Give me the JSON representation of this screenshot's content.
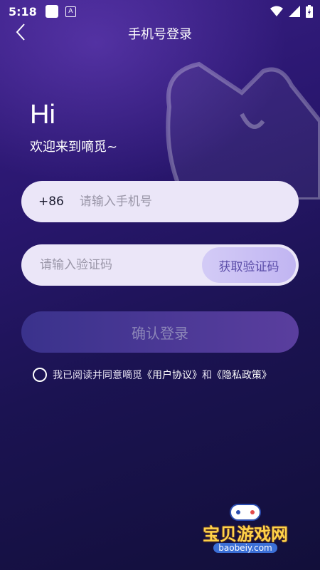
{
  "status": {
    "time": "5:18",
    "a_label": "A"
  },
  "header": {
    "title": "手机号登录"
  },
  "greeting": {
    "hi": "Hi",
    "welcome": "欢迎来到嘀觅~"
  },
  "phone": {
    "prefix": "+86",
    "placeholder": "请输入手机号"
  },
  "code": {
    "placeholder": "请输入验证码",
    "button": "获取验证码"
  },
  "login": {
    "button": "确认登录"
  },
  "agreement": {
    "text": "我已阅读并同意嘀觅",
    "user_agreement": "《用户协议》",
    "and": "和",
    "privacy_policy": "《隐私政策》"
  },
  "watermark": {
    "title": "宝贝游戏网",
    "url": "baobeiy.com"
  },
  "colors": {
    "accent": "#c1b5f2",
    "bg_top": "#3a1f86",
    "bg_bottom": "#120f3a"
  }
}
